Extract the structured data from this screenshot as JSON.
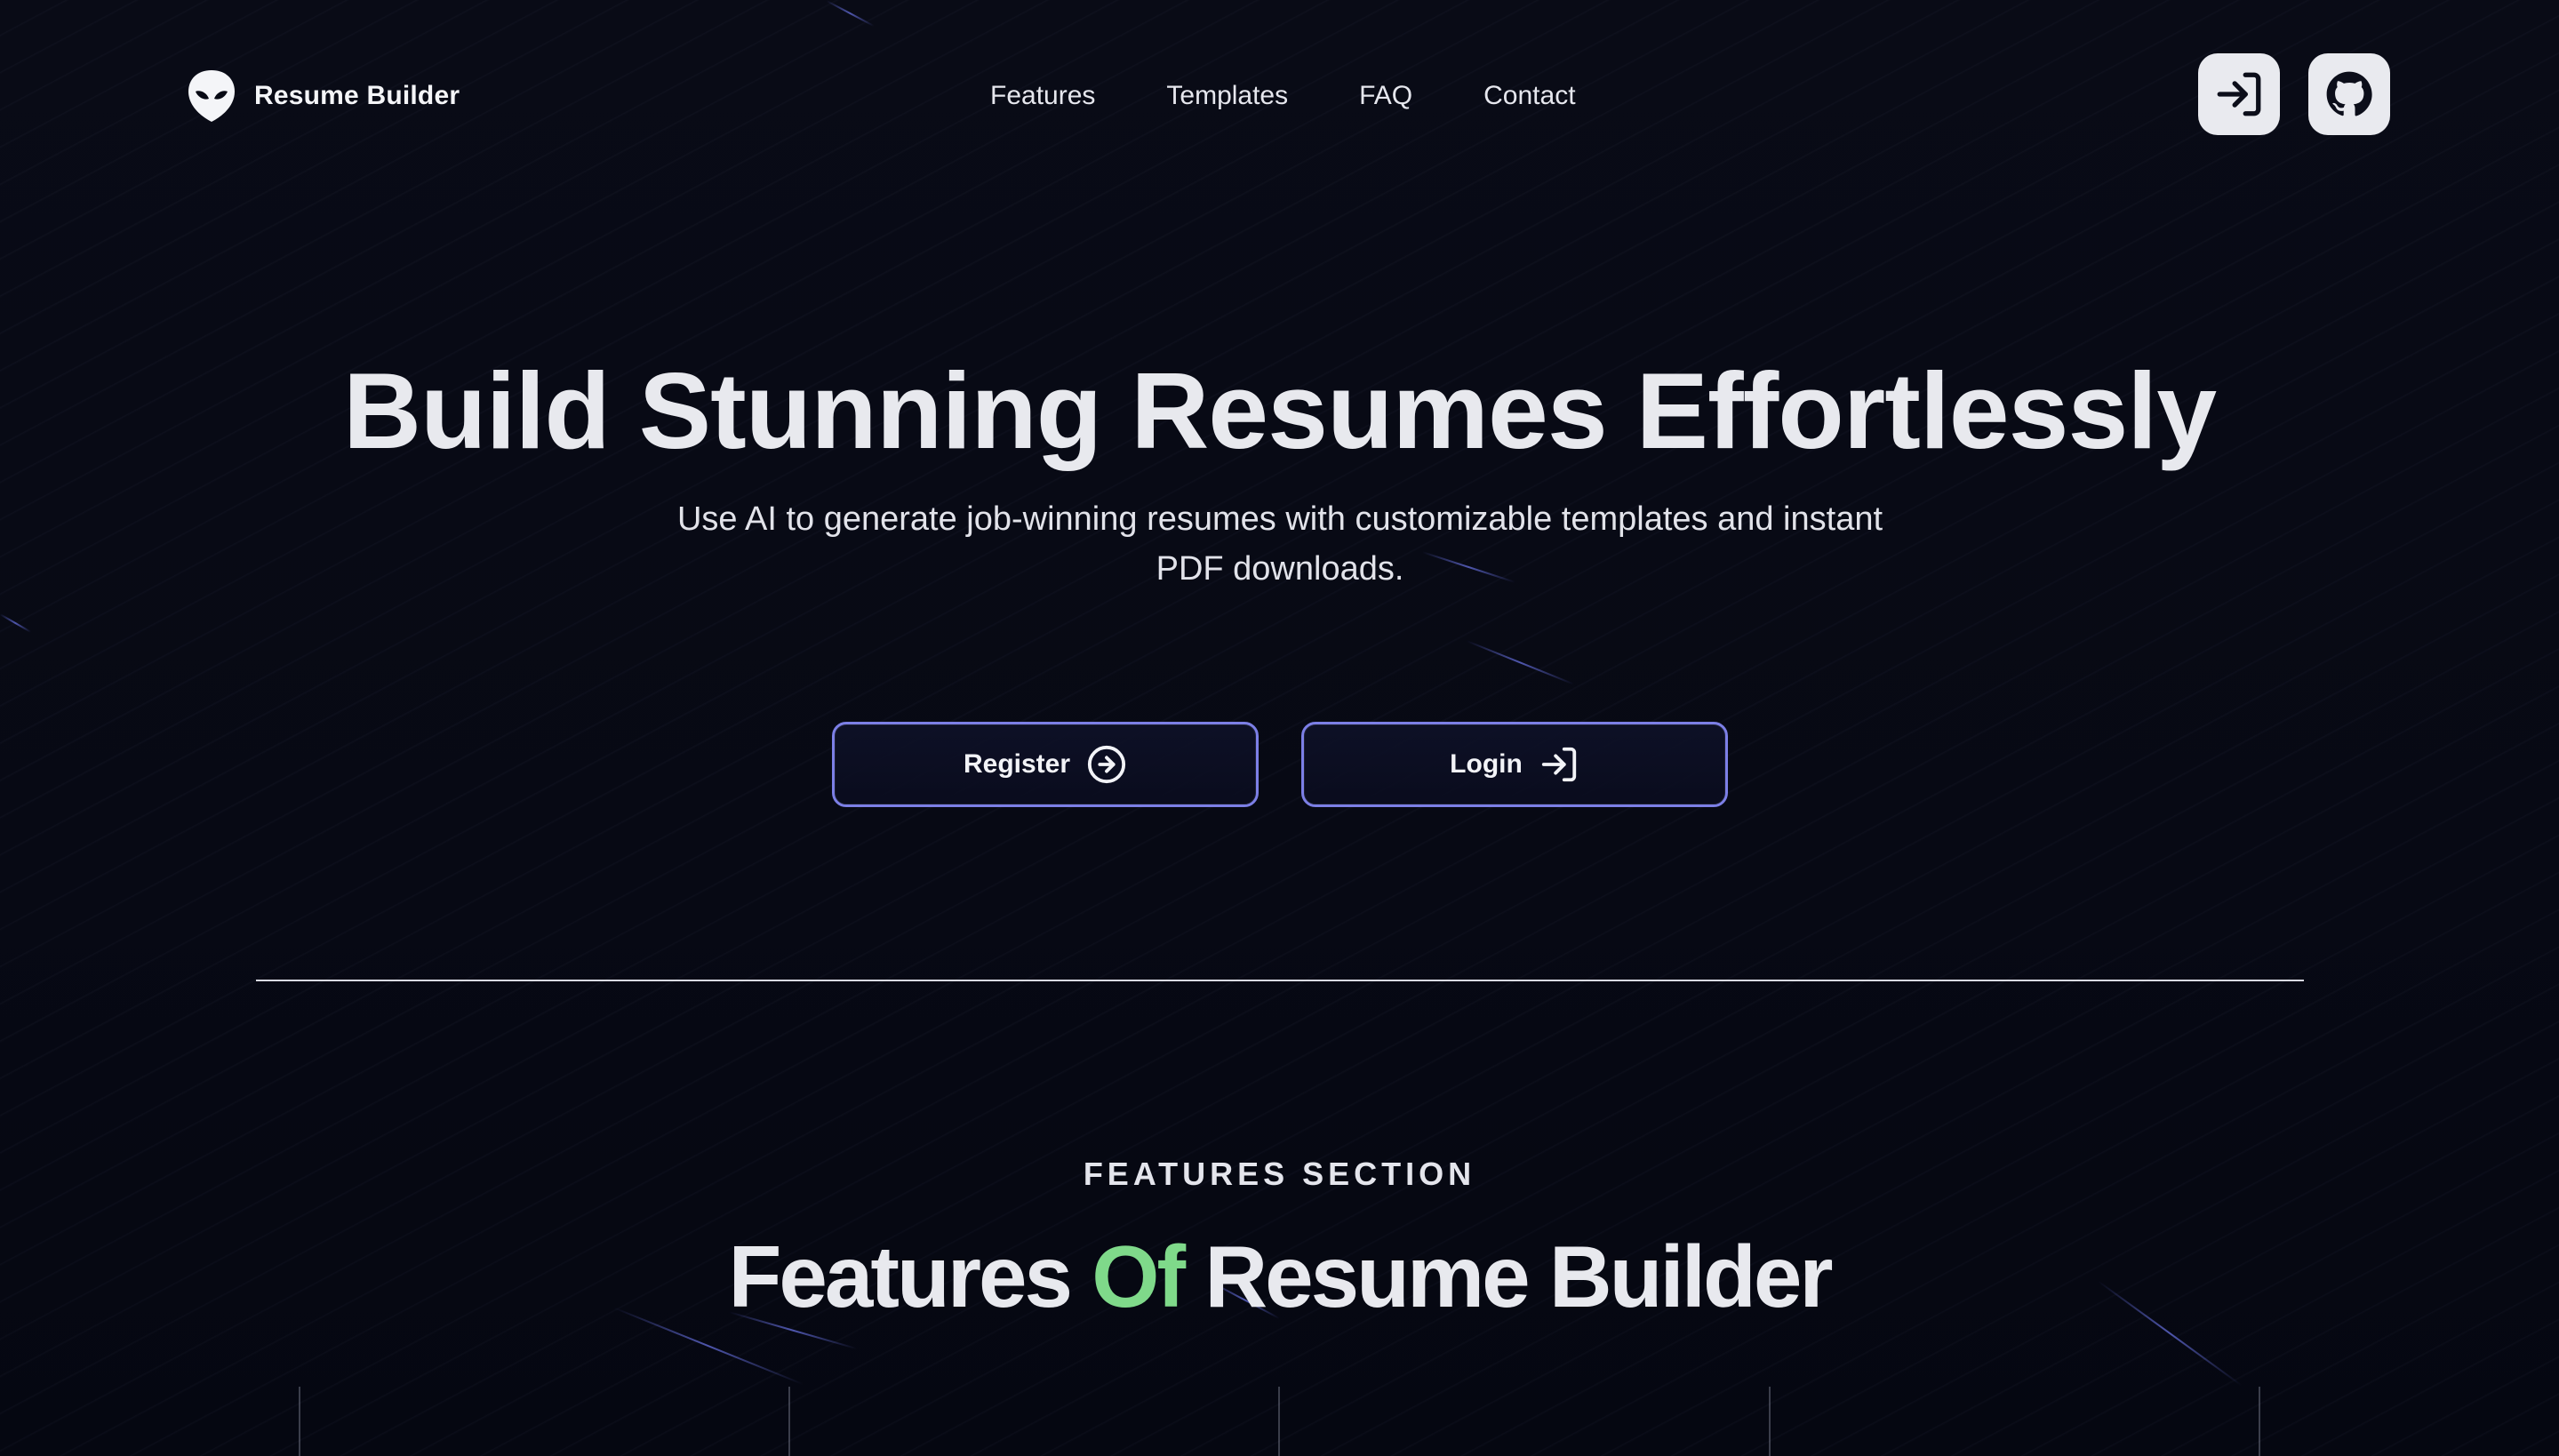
{
  "brand": {
    "name": "Resume Builder",
    "logo_icon": "alien-head-icon"
  },
  "nav": {
    "items": [
      {
        "label": "Features"
      },
      {
        "label": "Templates"
      },
      {
        "label": "FAQ"
      },
      {
        "label": "Contact"
      }
    ],
    "actions": [
      {
        "icon": "login-icon"
      },
      {
        "icon": "github-icon"
      }
    ]
  },
  "hero": {
    "title": "Build Stunning Resumes Effortlessly",
    "subtitle": "Use AI to generate job-winning resumes with customizable templates and instant PDF downloads.",
    "buttons": [
      {
        "label": "Register",
        "icon": "arrow-right-circle-icon"
      },
      {
        "label": "Login",
        "icon": "login-icon"
      }
    ]
  },
  "features": {
    "kicker": "FEATURES SECTION",
    "title_part1": "Features ",
    "title_accent": "Of",
    "title_part2": " Resume Builder"
  },
  "colors": {
    "background": "#070914",
    "accent_green": "#7fd98a",
    "button_border": "#7c7fe6",
    "icon_button_bg": "#e9eaef"
  }
}
